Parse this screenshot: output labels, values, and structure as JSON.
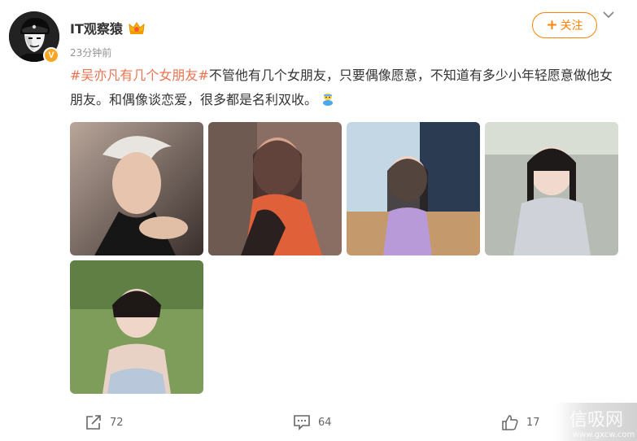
{
  "post": {
    "author": "IT观察猿",
    "verified_badge": "V",
    "time": "23分钟前",
    "follow_label": "关注",
    "hashtag": "#吴亦凡有几个女朋友#",
    "body": "不管他有几个女朋友，只要偶像愿意，不知道有多少小年轻愿意做他女朋友。和偶像谈恋爱，很多都是名利双收。",
    "emoji": "emoji-icon",
    "images": [
      {
        "name": "photo-1"
      },
      {
        "name": "photo-2"
      },
      {
        "name": "photo-3"
      },
      {
        "name": "photo-4"
      },
      {
        "name": "photo-5"
      }
    ]
  },
  "actions": {
    "share_count": "72",
    "comment_count": "64",
    "like_count": "17"
  },
  "watermark": {
    "text": "信吸网",
    "url": "www.gxcw.com"
  },
  "colors": {
    "accent": "#ff8200",
    "hashtag": "#eb7350",
    "badge": "#f6a623"
  }
}
